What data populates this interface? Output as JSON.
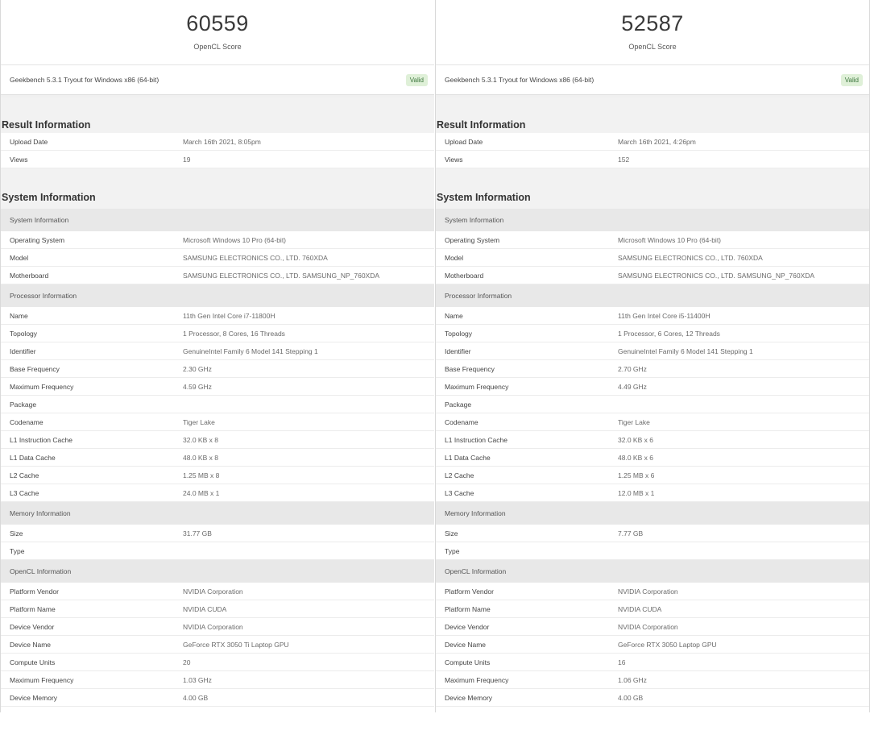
{
  "left": {
    "score": "60559",
    "score_label": "OpenCL Score",
    "version": "Geekbench 5.3.1 Tryout for Windows x86 (64-bit)",
    "valid": "Valid",
    "result_title": "Result Information",
    "result_rows": [
      {
        "k": "Upload Date",
        "v": "March 16th 2021, 8:05pm"
      },
      {
        "k": "Views",
        "v": "19"
      }
    ],
    "system_title": "System Information",
    "sys_head": "System Information",
    "sys_rows": [
      {
        "k": "Operating System",
        "v": "Microsoft Windows 10 Pro (64-bit)"
      },
      {
        "k": "Model",
        "v": "SAMSUNG ELECTRONICS CO., LTD. 760XDA"
      },
      {
        "k": "Motherboard",
        "v": "SAMSUNG ELECTRONICS CO., LTD. SAMSUNG_NP_760XDA"
      }
    ],
    "proc_head": "Processor Information",
    "proc_rows": [
      {
        "k": "Name",
        "v": "11th Gen Intel Core i7-11800H"
      },
      {
        "k": "Topology",
        "v": "1 Processor, 8 Cores, 16 Threads"
      },
      {
        "k": "Identifier",
        "v": "GenuineIntel Family 6 Model 141 Stepping 1"
      },
      {
        "k": "Base Frequency",
        "v": "2.30 GHz"
      },
      {
        "k": "Maximum Frequency",
        "v": "4.59 GHz"
      },
      {
        "k": "Package",
        "v": ""
      },
      {
        "k": "Codename",
        "v": "Tiger Lake"
      },
      {
        "k": "L1 Instruction Cache",
        "v": "32.0 KB x 8"
      },
      {
        "k": "L1 Data Cache",
        "v": "48.0 KB x 8"
      },
      {
        "k": "L2 Cache",
        "v": "1.25 MB x 8"
      },
      {
        "k": "L3 Cache",
        "v": "24.0 MB x 1"
      }
    ],
    "mem_head": "Memory Information",
    "mem_rows": [
      {
        "k": "Size",
        "v": "31.77 GB"
      },
      {
        "k": "Type",
        "v": ""
      }
    ],
    "ocl_head": "OpenCL Information",
    "ocl_rows": [
      {
        "k": "Platform Vendor",
        "v": "NVIDIA Corporation"
      },
      {
        "k": "Platform Name",
        "v": "NVIDIA CUDA"
      },
      {
        "k": "Device Vendor",
        "v": "NVIDIA Corporation"
      },
      {
        "k": "Device Name",
        "v": "GeForce RTX 3050 Ti Laptop GPU"
      },
      {
        "k": "Compute Units",
        "v": "20"
      },
      {
        "k": "Maximum Frequency",
        "v": "1.03 GHz"
      },
      {
        "k": "Device Memory",
        "v": "4.00 GB"
      }
    ]
  },
  "right": {
    "score": "52587",
    "score_label": "OpenCL Score",
    "version": "Geekbench 5.3.1 Tryout for Windows x86 (64-bit)",
    "valid": "Valid",
    "result_title": "Result Information",
    "result_rows": [
      {
        "k": "Upload Date",
        "v": "March 16th 2021, 4:26pm"
      },
      {
        "k": "Views",
        "v": "152"
      }
    ],
    "system_title": "System Information",
    "sys_head": "System Information",
    "sys_rows": [
      {
        "k": "Operating System",
        "v": "Microsoft Windows 10 Pro (64-bit)"
      },
      {
        "k": "Model",
        "v": "SAMSUNG ELECTRONICS CO., LTD. 760XDA"
      },
      {
        "k": "Motherboard",
        "v": "SAMSUNG ELECTRONICS CO., LTD. SAMSUNG_NP_760XDA"
      }
    ],
    "proc_head": "Processor Information",
    "proc_rows": [
      {
        "k": "Name",
        "v": "11th Gen Intel Core i5-11400H"
      },
      {
        "k": "Topology",
        "v": "1 Processor, 6 Cores, 12 Threads"
      },
      {
        "k": "Identifier",
        "v": "GenuineIntel Family 6 Model 141 Stepping 1"
      },
      {
        "k": "Base Frequency",
        "v": "2.70 GHz"
      },
      {
        "k": "Maximum Frequency",
        "v": "4.49 GHz"
      },
      {
        "k": "Package",
        "v": ""
      },
      {
        "k": "Codename",
        "v": "Tiger Lake"
      },
      {
        "k": "L1 Instruction Cache",
        "v": "32.0 KB x 6"
      },
      {
        "k": "L1 Data Cache",
        "v": "48.0 KB x 6"
      },
      {
        "k": "L2 Cache",
        "v": "1.25 MB x 6"
      },
      {
        "k": "L3 Cache",
        "v": "12.0 MB x 1"
      }
    ],
    "mem_head": "Memory Information",
    "mem_rows": [
      {
        "k": "Size",
        "v": "7.77 GB"
      },
      {
        "k": "Type",
        "v": ""
      }
    ],
    "ocl_head": "OpenCL Information",
    "ocl_rows": [
      {
        "k": "Platform Vendor",
        "v": "NVIDIA Corporation"
      },
      {
        "k": "Platform Name",
        "v": "NVIDIA CUDA"
      },
      {
        "k": "Device Vendor",
        "v": "NVIDIA Corporation"
      },
      {
        "k": "Device Name",
        "v": "GeForce RTX 3050 Laptop GPU"
      },
      {
        "k": "Compute Units",
        "v": "16"
      },
      {
        "k": "Maximum Frequency",
        "v": "1.06 GHz"
      },
      {
        "k": "Device Memory",
        "v": "4.00 GB"
      }
    ]
  }
}
